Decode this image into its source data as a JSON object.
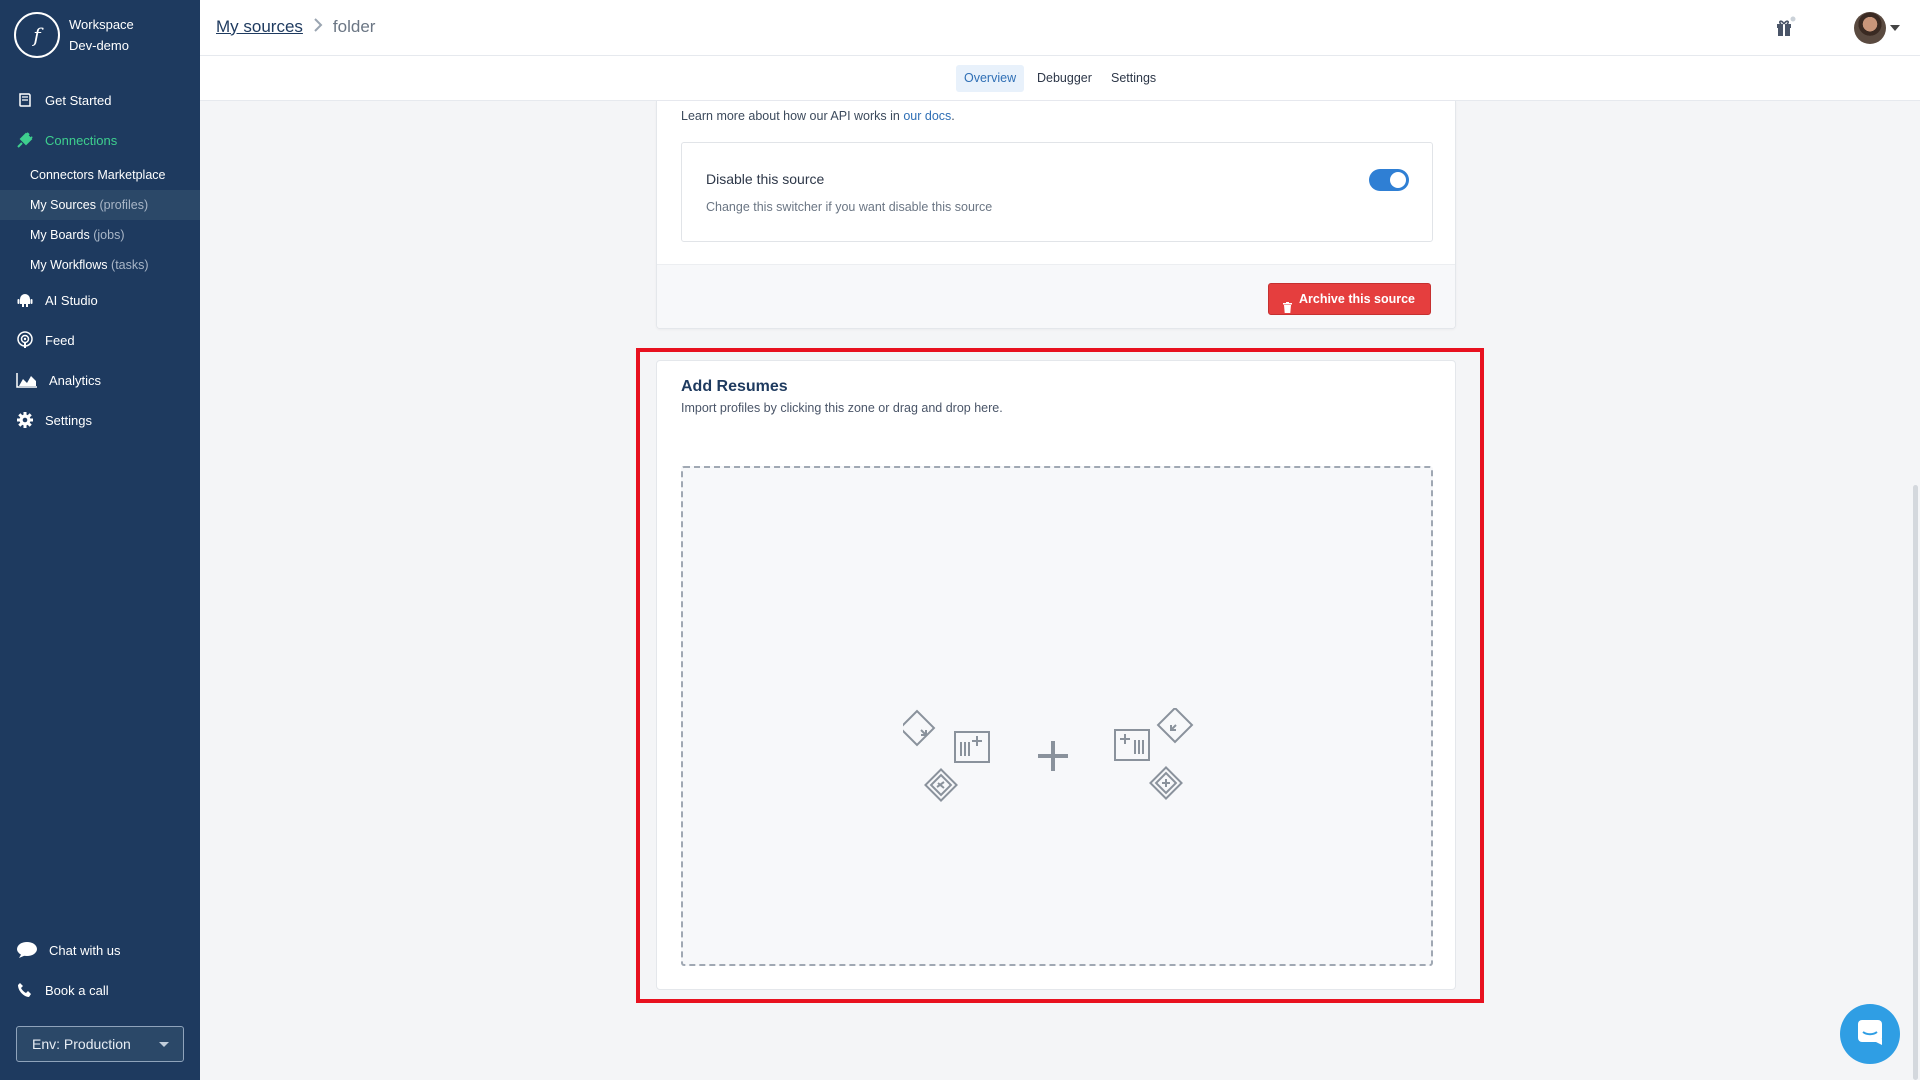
{
  "workspace": {
    "logo_glyph": "f",
    "line1": "Workspace",
    "line2": "Dev-demo"
  },
  "sidebar": {
    "items": [
      {
        "label": "Get Started",
        "icon": "book-icon"
      },
      {
        "label": "Connections",
        "icon": "plug-icon",
        "active": true
      },
      {
        "label": "AI Studio",
        "icon": "android-icon"
      },
      {
        "label": "Feed",
        "icon": "podcast-icon"
      },
      {
        "label": "Analytics",
        "icon": "area-chart-icon"
      },
      {
        "label": "Settings",
        "icon": "gear-icon"
      }
    ],
    "sub_items": [
      {
        "label": "Connectors Marketplace",
        "muted": ""
      },
      {
        "label": "My Sources",
        "muted": "(profiles)",
        "selected": true
      },
      {
        "label": "My Boards",
        "muted": "(jobs)"
      },
      {
        "label": "My Workflows",
        "muted": "(tasks)"
      }
    ],
    "bottom": [
      {
        "label": "Chat with us",
        "icon": "chat-icon"
      },
      {
        "label": "Book a call",
        "icon": "phone-icon"
      }
    ],
    "env_label": "Env: Production"
  },
  "breadcrumb": {
    "link": "My sources",
    "separator": ">",
    "current": "folder"
  },
  "tabs": [
    {
      "label": "Overview",
      "active": true
    },
    {
      "label": "Debugger"
    },
    {
      "label": "Settings"
    }
  ],
  "source_card": {
    "learn_prefix": "Learn more about how our API works in ",
    "learn_link": "our docs",
    "learn_suffix": ".",
    "disable_title": "Disable this source",
    "disable_sub": "Change this switcher if you want disable this source",
    "toggle_on": true,
    "archive_label": "Archive this source"
  },
  "resumes_card": {
    "title": "Add Resumes",
    "subtitle": "Import profiles by clicking this zone or drag and drop here."
  },
  "colors": {
    "sidebar_bg": "#1e3a5f",
    "accent_green": "#3ecf8e",
    "danger": "#e53e3e",
    "highlight": "#e8111f",
    "primary": "#2f7fd4"
  }
}
